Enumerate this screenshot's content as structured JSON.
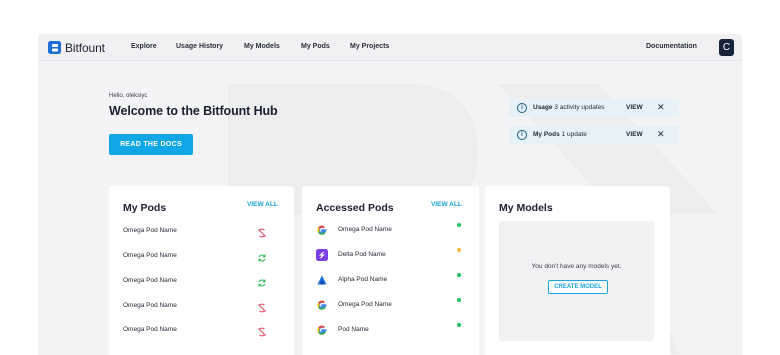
{
  "app": {
    "name": "Bitfount"
  },
  "nav": {
    "items": [
      {
        "label": "Explore"
      },
      {
        "label": "Usage History"
      },
      {
        "label": "My Models"
      },
      {
        "label": "My Pods"
      },
      {
        "label": "My Projects"
      }
    ],
    "documentation": "Documentation",
    "avatar_letter": "C"
  },
  "hero": {
    "greeting": "Hello, oleksiyc",
    "title": "Welcome to the Bitfount Hub",
    "docs_button": "READ THE DOCS"
  },
  "notifications": [
    {
      "title": "Usage",
      "text": "3 activity updates",
      "view": "VIEW",
      "close": "✕"
    },
    {
      "title": "My Pods",
      "text": "1 update",
      "view": "VIEW",
      "close": "✕"
    }
  ],
  "my_pods": {
    "title": "My Pods",
    "view_all": "VIEW ALL",
    "rows": [
      {
        "name": "Omega Pod Name",
        "status": "disconnected",
        "status_color": "#e2445c"
      },
      {
        "name": "Omega Pod Name",
        "status": "syncing",
        "status_color": "#2db84c"
      },
      {
        "name": "Omega Pod Name",
        "status": "syncing",
        "status_color": "#2db84c"
      },
      {
        "name": "Omega Pod Name",
        "status": "disconnected",
        "status_color": "#e2445c"
      },
      {
        "name": "Omega Pod Name",
        "status": "disconnected",
        "status_color": "#e2445c"
      }
    ]
  },
  "accessed_pods": {
    "title": "Accessed Pods",
    "view_all": "VIEW ALL",
    "rows": [
      {
        "name": "Omega Pod Name",
        "icon": "google-icon",
        "status_color": "#22c55e"
      },
      {
        "name": "Delta Pod Name",
        "icon": "delta-icon",
        "status_color": "#f5b93c"
      },
      {
        "name": "Alpha Pod Name",
        "icon": "alpha-icon",
        "status_color": "#22c55e"
      },
      {
        "name": "Omega Pod Name",
        "icon": "google-icon",
        "status_color": "#22c55e"
      },
      {
        "name": "Pod Name",
        "icon": "google-icon",
        "status_color": "#22c55e"
      }
    ]
  },
  "my_models": {
    "title": "My Models",
    "empty_text": "You don't have any models yet.",
    "create_button": "CREATE MODEL"
  },
  "colors": {
    "accent": "#11a6e5",
    "brand": "#1d6fd6",
    "dark": "#17233b"
  }
}
